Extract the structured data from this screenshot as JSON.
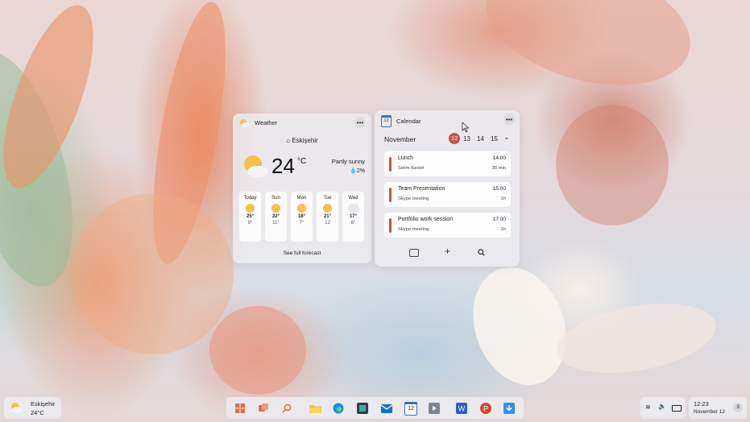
{
  "colors": {
    "accent_red": "#c8524a",
    "sun_yellow": "#f2c14a",
    "widget_bg": "#ececf0"
  },
  "weather": {
    "title": "Weather",
    "location": "Eskişehir",
    "temp": "24",
    "unit": "°C",
    "condition": "Partly sunny",
    "precip": "2%",
    "forecast": [
      {
        "day": "Today",
        "hi": "25°",
        "lo": "9°",
        "icon": "partly-sunny-icon"
      },
      {
        "day": "Sun",
        "hi": "22°",
        "lo": "11°",
        "icon": "sunny-icon"
      },
      {
        "day": "Mon",
        "hi": "18°",
        "lo": "7°",
        "icon": "partly-sunny-icon"
      },
      {
        "day": "Tue",
        "hi": "21°",
        "lo": "12",
        "icon": "sunny-icon"
      },
      {
        "day": "Wed",
        "hi": "17°",
        "lo": "6°",
        "icon": "cloudy-icon"
      }
    ],
    "see_forecast": "See full forecast"
  },
  "calendar": {
    "title": "Calendar",
    "icon_num": "12",
    "month": "November",
    "days": [
      "12",
      "13",
      "14",
      "15"
    ],
    "events": [
      {
        "title": "Lunch",
        "sub": "Selim Kestel",
        "time": "14:00",
        "dur": "30 min"
      },
      {
        "title": "Team Presentation",
        "sub": "Skype meeting",
        "time": "15:00",
        "dur": "1h"
      },
      {
        "title": "Portfolio work session",
        "sub": "Skype meeting",
        "time": "17:00",
        "dur": "1h"
      }
    ]
  },
  "taskbar": {
    "weather_location": "Eskişehir",
    "weather_temp": "24°C",
    "calendar_num": "12",
    "clock_time": "12:23",
    "clock_date": "November 12",
    "notif_count": "3"
  }
}
